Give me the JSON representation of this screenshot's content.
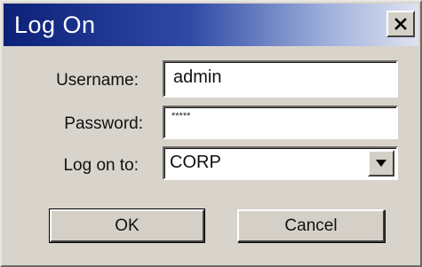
{
  "window": {
    "title": "Log On"
  },
  "form": {
    "username_label": "Username:",
    "username_value": "admin",
    "password_label": "Password:",
    "password_value": "*****",
    "logon_label": "Log on to:",
    "logon_value": "CORP"
  },
  "buttons": {
    "ok_label": "OK",
    "cancel_label": "Cancel"
  },
  "icons": {
    "close": "close-icon",
    "dropdown": "chevron-down-icon"
  },
  "colors": {
    "titlebar_start": "#0c2178",
    "titlebar_end": "#dfe3ef",
    "dialog_bg": "#d8d4cc"
  }
}
